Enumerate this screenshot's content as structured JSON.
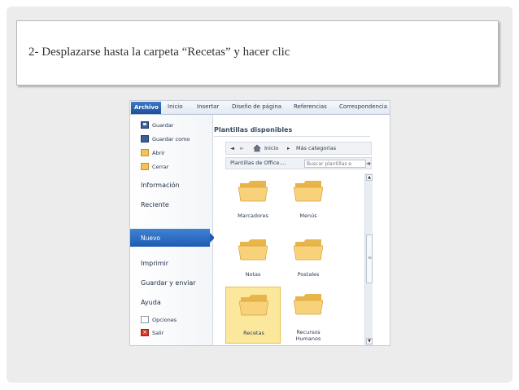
{
  "slide": {
    "title": "2- Desplazarse hasta la carpeta “Recetas” y hacer clic"
  },
  "ribbon": {
    "tabs": [
      "Archivo",
      "Inicio",
      "Insertar",
      "Diseño de página",
      "Referencias",
      "Correspondencia"
    ]
  },
  "backstage": {
    "items": {
      "guardar": "Guardar",
      "guardar_como": "Guardar como",
      "abrir": "Abrir",
      "cerrar": "Cerrar",
      "informacion": "Información",
      "reciente": "Reciente",
      "nuevo": "Nuevo",
      "imprimir": "Imprimir",
      "guardar_enviar": "Guardar y enviar",
      "ayuda": "Ayuda",
      "opciones": "Opciones",
      "salir": "Salir"
    },
    "selected": "Nuevo"
  },
  "templates": {
    "title": "Plantillas disponibles",
    "nav": {
      "back": "◄",
      "forward": "►",
      "home": "Inicio",
      "separator": "▸",
      "more": "Más categorías"
    },
    "location": "Plantillas de Office....",
    "search_placeholder": "Buscar plantillas e",
    "search_go": "➜",
    "folders": [
      "Marcadores",
      "Menús",
      "Notas",
      "Postales",
      "Recetas",
      "Recursos Humanos"
    ],
    "selected_folder": "Recetas"
  },
  "icons": {
    "home": "house-icon",
    "folder": "folder-icon",
    "scroll_up": "▲",
    "scroll_down": "▼",
    "scroll_grip": "≡"
  },
  "colors": {
    "selection_blue": "#2a6cc4",
    "folder_highlight": "#fce89d",
    "folder_yellow": "#f2c35a"
  }
}
